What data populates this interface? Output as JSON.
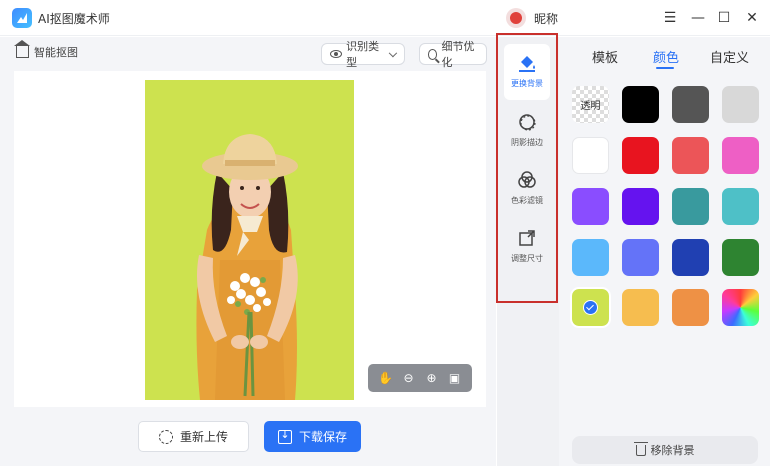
{
  "app": {
    "title": "AI抠图魔术师",
    "nickname": "昵称"
  },
  "window_controls": {
    "menu": "☰",
    "minimize": "—",
    "maximize": "☐",
    "close": "✕"
  },
  "toolbar": {
    "smart_cutout": "智能抠图",
    "recognize_type": "识别类型",
    "detail_optimize": "细节优化"
  },
  "actions": {
    "reupload": "重新上传",
    "download_save": "下载保存"
  },
  "tools": [
    {
      "label": "更换背景",
      "icon": "paint-bucket-icon",
      "active": true
    },
    {
      "label": "阴影描边",
      "icon": "shadow-outline-icon",
      "active": false
    },
    {
      "label": "色彩滤镜",
      "icon": "color-filter-icon",
      "active": false
    },
    {
      "label": "调整尺寸",
      "icon": "resize-icon",
      "active": false
    }
  ],
  "tabs": [
    {
      "label": "模板",
      "active": false
    },
    {
      "label": "颜色",
      "active": true
    },
    {
      "label": "自定义",
      "active": false
    }
  ],
  "swatches": [
    {
      "name": "transparent",
      "label": "透明"
    },
    {
      "name": "black",
      "color": "#000000"
    },
    {
      "name": "dark-gray",
      "color": "#555555"
    },
    {
      "name": "light-gray",
      "color": "#d8d8d8"
    },
    {
      "name": "white",
      "color": "#ffffff"
    },
    {
      "name": "red",
      "color": "#e8141f"
    },
    {
      "name": "light-red",
      "color": "#ec5558"
    },
    {
      "name": "pink",
      "color": "#ee5fc5"
    },
    {
      "name": "purple",
      "color": "#8a4dff"
    },
    {
      "name": "violet",
      "color": "#6513ef"
    },
    {
      "name": "teal",
      "color": "#399a9e"
    },
    {
      "name": "cyan",
      "color": "#4ec0c7"
    },
    {
      "name": "sky-blue",
      "color": "#5bb8fb"
    },
    {
      "name": "periwinkle",
      "color": "#6473f8"
    },
    {
      "name": "navy",
      "color": "#2040b2"
    },
    {
      "name": "green",
      "color": "#2e8431"
    },
    {
      "name": "lime",
      "color": "#cde24f",
      "selected": true
    },
    {
      "name": "yellow-orange",
      "color": "#f6bd4f"
    },
    {
      "name": "orange",
      "color": "#ee9145"
    },
    {
      "name": "rainbow"
    }
  ],
  "remove_background": "移除背景",
  "colors": {
    "accent": "#2a72f5",
    "photo_background": "#cde24f",
    "highlight_border": "#c9302c"
  }
}
